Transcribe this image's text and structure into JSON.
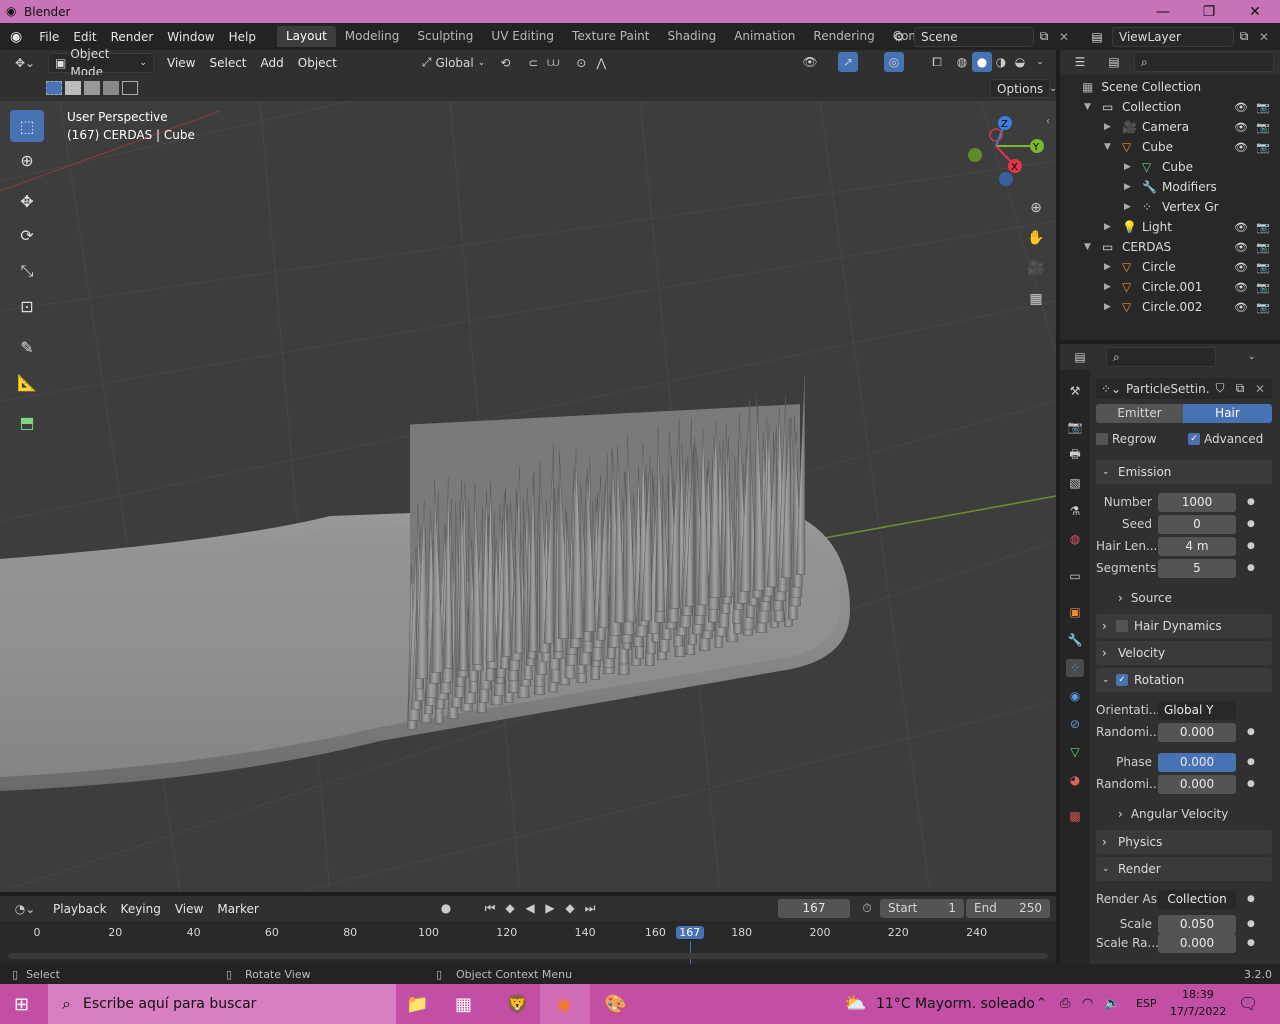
{
  "window": {
    "title": "Blender",
    "minimize": "—",
    "maximize": "❐",
    "close": "✕"
  },
  "menu": [
    "File",
    "Edit",
    "Render",
    "Window",
    "Help"
  ],
  "workspaces": [
    "Layout",
    "Modeling",
    "Sculpting",
    "UV Editing",
    "Texture Paint",
    "Shading",
    "Animation",
    "Rendering",
    "Compositing"
  ],
  "scene": "Scene",
  "view_layer": "ViewLayer",
  "viewport_header": {
    "mode": "Object Mode",
    "view": "View",
    "select": "Select",
    "add": "Add",
    "object": "Object",
    "transform": "Global"
  },
  "options_label": "Options",
  "viewport": {
    "perspective": "User Perspective",
    "object_info": "(167) CERDAS | Cube"
  },
  "gizmo": {
    "x": "X",
    "y": "Y",
    "z": "Z"
  },
  "outliner": {
    "root": "Scene Collection",
    "rows": [
      {
        "label": "Collection",
        "tri": "▼"
      },
      {
        "label": "Camera",
        "tri": "▶"
      },
      {
        "label": "Cube",
        "tri": "▼"
      },
      {
        "label": "Cube",
        "tri": "▶"
      },
      {
        "label": "Modifiers",
        "tri": "▶"
      },
      {
        "label": "Vertex Gr",
        "tri": "▶"
      },
      {
        "label": "Light",
        "tri": "▶"
      },
      {
        "label": "CERDAS",
        "tri": "▼"
      },
      {
        "label": "Circle",
        "tri": "▶"
      },
      {
        "label": "Circle.001",
        "tri": "▶"
      },
      {
        "label": "Circle.002",
        "tri": "▶"
      }
    ]
  },
  "properties": {
    "particle_settings": "ParticleSettin...",
    "type_tabs": [
      "Emitter",
      "Hair"
    ],
    "regrow": "Regrow",
    "advanced": "Advanced",
    "emission": {
      "title": "Emission",
      "number_label": "Number",
      "number": "1000",
      "seed_label": "Seed",
      "seed": "0",
      "hair_len_label": "Hair Len...",
      "hair_len": "4 m",
      "segments_label": "Segments",
      "segments": "5",
      "source": "Source"
    },
    "hair_dynamics": "Hair Dynamics",
    "velocity": "Velocity",
    "rotation": {
      "title": "Rotation",
      "orientation_label": "Orientati...",
      "orientation": "Global Y",
      "random_label": "Randomi...",
      "random": "0.000",
      "phase_label": "Phase",
      "phase": "0.000",
      "random2_label": "Randomi...",
      "random2": "0.000",
      "angular": "Angular Velocity"
    },
    "physics": "Physics",
    "render": {
      "title": "Render",
      "render_as_label": "Render As",
      "render_as": "Collection",
      "scale_label": "Scale",
      "scale": "0.050",
      "scale_rand_label": "Scale Ra...",
      "scale_rand": "0.000"
    }
  },
  "timeline": {
    "playback": "Playback",
    "keying": "Keying",
    "view": "View",
    "marker": "Marker",
    "current_frame": "167",
    "start_label": "Start",
    "start": "1",
    "end_label": "End",
    "end": "250",
    "ticks": [
      "0",
      "20",
      "40",
      "60",
      "80",
      "100",
      "120",
      "140",
      "160",
      "167",
      "180",
      "200",
      "220",
      "240"
    ]
  },
  "status": {
    "select": "Select",
    "rotate": "Rotate View",
    "context": "Object Context Menu",
    "version": "3.2.0"
  },
  "taskbar": {
    "search_placeholder": "Escribe aquí para buscar",
    "weather": "11°C  Mayorm. soleado",
    "lang": "ESP",
    "time": "18:39",
    "date": "17/7/2022"
  }
}
